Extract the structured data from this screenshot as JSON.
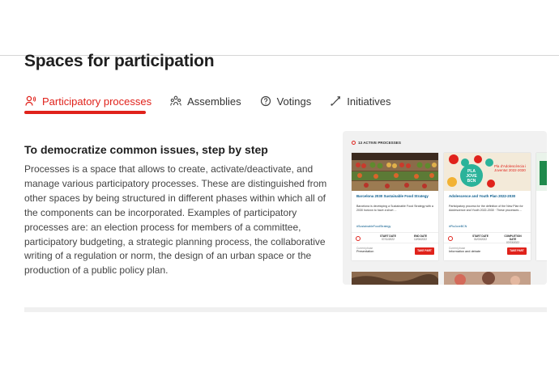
{
  "page": {
    "title": "Spaces for participation"
  },
  "tabs": [
    {
      "label": "Participatory processes",
      "icon": "participants-icon",
      "active": true
    },
    {
      "label": "Assemblies",
      "icon": "assemblies-icon",
      "active": false
    },
    {
      "label": "Votings",
      "icon": "votings-icon",
      "active": false
    },
    {
      "label": "Initiatives",
      "icon": "initiatives-icon",
      "active": false
    }
  ],
  "intro": {
    "subtitle": "To democratize common issues, step by step",
    "description": "Processes is a space that allows to create, activate/deactivate, and manage various participatory processes. These are distinguished from other spaces by being structured in different phases within which all of the components can be incorporated. Examples of participatory processes are: an election process for members of a committee, participatory budgeting, a strategic planning process, the collaborative writing of a regulation or norm, the design of an urban space or the production of a public policy plan."
  },
  "preview": {
    "header": "13 ACTIVE PROCESSES",
    "cards": [
      {
        "title": "Barcelona 2030 Sustainable Food Strategy",
        "text": "Barcelona is developing a Sustainable Food Strategy with a 2030 horizon to have a short ...",
        "tag": "#SustainableFoodStrategy",
        "start_label": "START DATE",
        "start_date": "07/11/2022",
        "end_label": "END DATE",
        "end_date": "12/06/2022",
        "phase_label": "Current phase",
        "phase": "Presentation",
        "cta": "TAKE PART"
      },
      {
        "title": "Adolescence and Youth Plan 2022-2030",
        "text": "Participatory process for the definition of the New Plan for Adolescence and Youth 2022-2030 · These processes ...",
        "tag": "#PlaJoveBCN",
        "start_label": "START DATE",
        "start_date": "01/03/2022",
        "end_label": "COMPLETION DATE",
        "end_date": "07/03/2022",
        "phase_label": "Current phase",
        "phase": "Information and debate",
        "cta": "TAKE PART",
        "poster_lines": [
          "PLA",
          "JOVE",
          "BCN"
        ],
        "poster_caption": "Pla d'Adolescència i Joventut 2022-2030"
      }
    ]
  }
}
